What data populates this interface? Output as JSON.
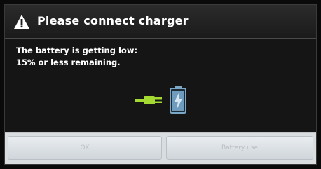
{
  "dialog": {
    "title": "Please connect charger",
    "icons": {
      "title_icon": "warning-icon",
      "plug": "plug-icon",
      "battery": "battery-charging-icon"
    },
    "message_lines": [
      "The battery is getting low:",
      "15% or less remaining."
    ],
    "buttons": {
      "ok_label": "OK",
      "battery_use_label": "Battery use"
    }
  },
  "colors": {
    "background": "#151515",
    "text": "#ffffff",
    "plug_green": "#a4d931",
    "battery_blue": "#7aa7c6"
  }
}
